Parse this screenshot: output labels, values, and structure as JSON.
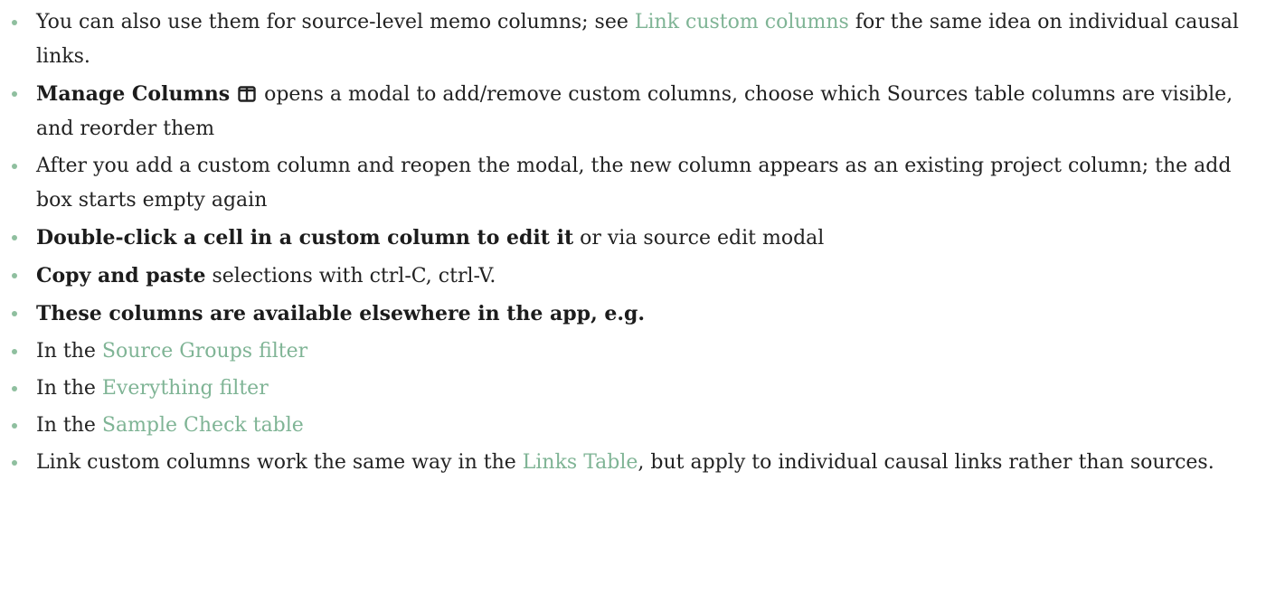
{
  "accent_color": "#7fb495",
  "bullet_color": "#8fbf9f",
  "items": [
    {
      "t1": "You can also use them for source-level memo columns; see ",
      "link": "Link custom columns",
      "t2": " for the same idea on individual causal links."
    },
    {
      "bold": "Manage Columns",
      "icon": "columns-icon",
      "t1": " opens a modal to add/remove custom columns, choose which Sources table columns are visible, and reorder them"
    },
    {
      "t1": "After you add a custom column and reopen the modal, the new column appears as an existing project column; the add box starts empty again"
    },
    {
      "bold": "Double-click a cell in a custom column to edit it",
      "t1": " or via source edit modal"
    },
    {
      "bold": "Copy and paste",
      "t1": " selections with ctrl-C, ctrl-V."
    },
    {
      "bold": "These columns are available elsewhere in the app, e.g."
    },
    {
      "t1": "In the ",
      "link": "Source Groups filter"
    },
    {
      "t1": "In the ",
      "link": "Everything filter"
    },
    {
      "t1": "In the ",
      "link": "Sample Check table"
    },
    {
      "t1": "Link custom columns work the same way in the ",
      "link": "Links Table",
      "t2": ", but apply to individual causal links rather than sources."
    }
  ]
}
